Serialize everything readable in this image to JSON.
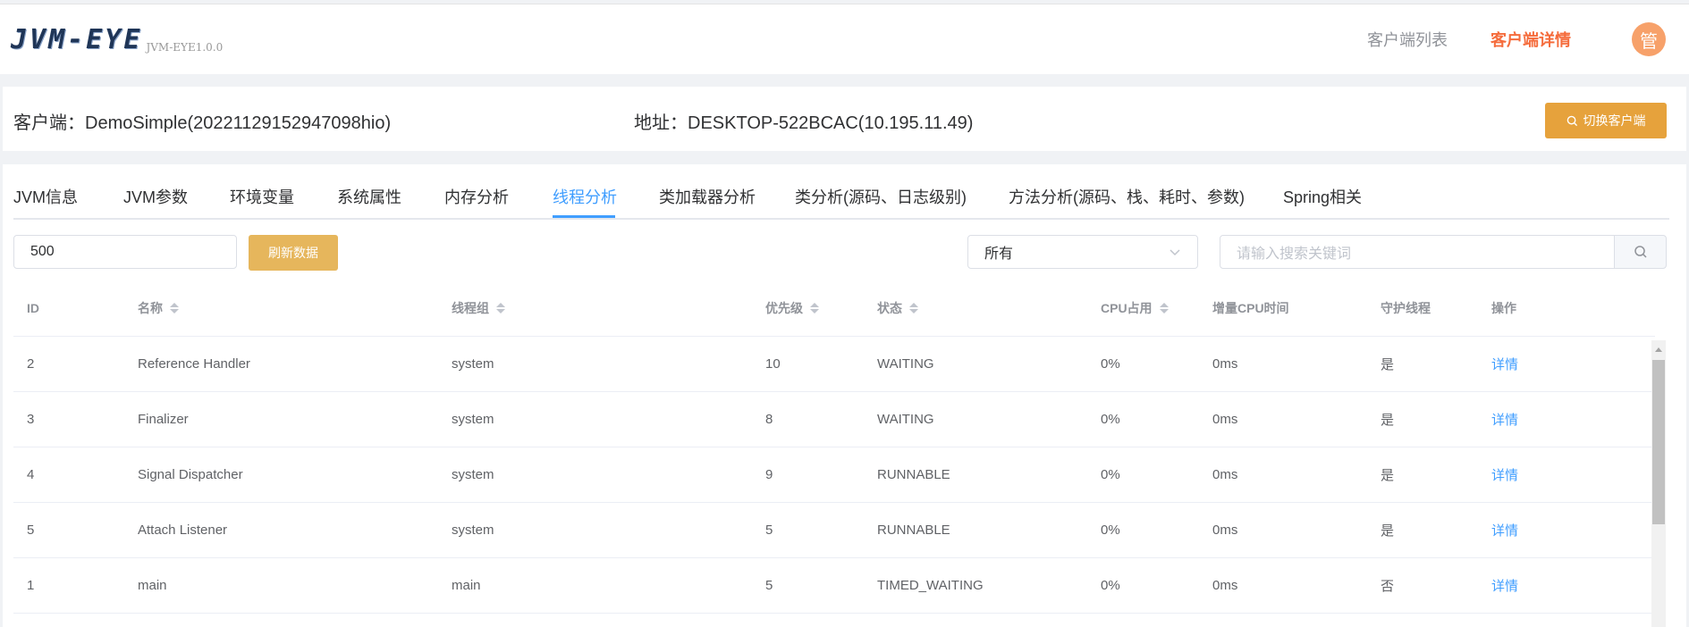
{
  "header": {
    "logo": "JVM-EYE",
    "version": "JVM-EYE1.0.0",
    "nav_list": "客户端列表",
    "nav_detail": "客户端详情",
    "avatar": "管"
  },
  "client": {
    "name": "客户端：DemoSimple(20221129152947098hio)",
    "address": "地址：DESKTOP-522BCAC(10.195.11.49)",
    "switch_label": "切换客户端"
  },
  "tabs": [
    {
      "label": "JVM信息"
    },
    {
      "label": "JVM参数"
    },
    {
      "label": "环境变量"
    },
    {
      "label": "系统属性"
    },
    {
      "label": "内存分析"
    },
    {
      "label": "线程分析",
      "active": true
    },
    {
      "label": "类加载器分析"
    },
    {
      "label": "类分析(源码、日志级别)"
    },
    {
      "label": "方法分析(源码、栈、耗时、参数)"
    },
    {
      "label": "Spring相关"
    }
  ],
  "toolbar": {
    "limit_value": "500",
    "refresh_label": "刷新数据",
    "filter_value": "所有",
    "search_placeholder": "请输入搜索关键词"
  },
  "table": {
    "columns": [
      "ID",
      "名称",
      "线程组",
      "优先级",
      "状态",
      "CPU占用",
      "增量CPU时间",
      "守护线程",
      "操作"
    ],
    "rows": [
      {
        "id": "2",
        "name": "Reference Handler",
        "group": "system",
        "priority": "10",
        "state": "WAITING",
        "cpu": "0%",
        "delta": "0ms",
        "daemon": "是",
        "action": "详情"
      },
      {
        "id": "3",
        "name": "Finalizer",
        "group": "system",
        "priority": "8",
        "state": "WAITING",
        "cpu": "0%",
        "delta": "0ms",
        "daemon": "是",
        "action": "详情"
      },
      {
        "id": "4",
        "name": "Signal Dispatcher",
        "group": "system",
        "priority": "9",
        "state": "RUNNABLE",
        "cpu": "0%",
        "delta": "0ms",
        "daemon": "是",
        "action": "详情"
      },
      {
        "id": "5",
        "name": "Attach Listener",
        "group": "system",
        "priority": "5",
        "state": "RUNNABLE",
        "cpu": "0%",
        "delta": "0ms",
        "daemon": "是",
        "action": "详情"
      },
      {
        "id": "1",
        "name": "main",
        "group": "main",
        "priority": "5",
        "state": "TIMED_WAITING",
        "cpu": "0%",
        "delta": "0ms",
        "daemon": "否",
        "action": "详情"
      }
    ]
  },
  "colors": {
    "accent": "#409eff",
    "warning": "#e6a23c",
    "nav_active": "#f56c3c"
  }
}
